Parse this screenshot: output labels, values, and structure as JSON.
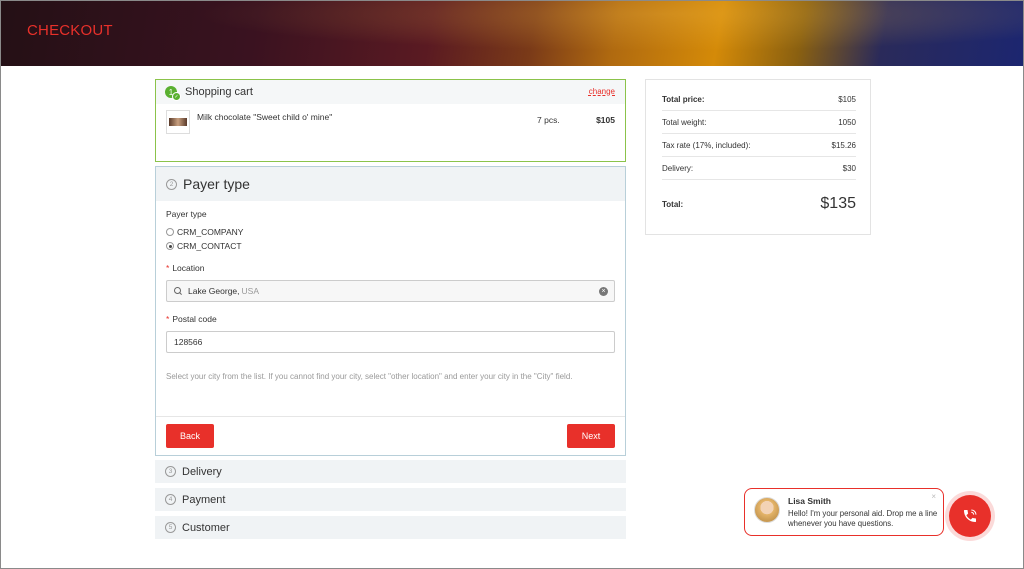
{
  "header": {
    "title": "CHECKOUT"
  },
  "cart": {
    "step": "✓",
    "title": "Shopping cart",
    "change_label": "change",
    "item": {
      "name": "Milk chocolate \"Sweet child o' mine\"",
      "qty": "7 pcs.",
      "price": "$105"
    }
  },
  "payer": {
    "step": "2",
    "title": "Payer type",
    "type_label": "Payer type",
    "options": [
      "CRM_COMPANY",
      "CRM_CONTACT"
    ],
    "selected": "CRM_CONTACT",
    "location_label": "Location",
    "location_city": "Lake George,",
    "location_country": "USA",
    "postal_label": "Postal code",
    "postal_value": "128566",
    "hint": "Select your city from the list. If you cannot find your city, select \"other location\" and enter your city in the \"City\" field.",
    "back_label": "Back",
    "next_label": "Next"
  },
  "steps": [
    {
      "num": "3",
      "title": "Delivery"
    },
    {
      "num": "4",
      "title": "Payment"
    },
    {
      "num": "5",
      "title": "Customer"
    }
  ],
  "summary": {
    "rows": [
      {
        "k": "Total price:",
        "v": "$105"
      },
      {
        "k": "Total weight:",
        "v": "1050"
      },
      {
        "k": "Tax rate (17%, included):",
        "v": "$15.26"
      },
      {
        "k": "Delivery:",
        "v": "$30"
      }
    ],
    "total_label": "Total:",
    "total_value": "$135"
  },
  "chat": {
    "name": "Lisa Smith",
    "message": "Hello! I'm your personal aid. Drop me a line whenever you have questions.",
    "close": "×"
  },
  "colors": {
    "accent": "#e8302a",
    "success": "#5ab030"
  }
}
